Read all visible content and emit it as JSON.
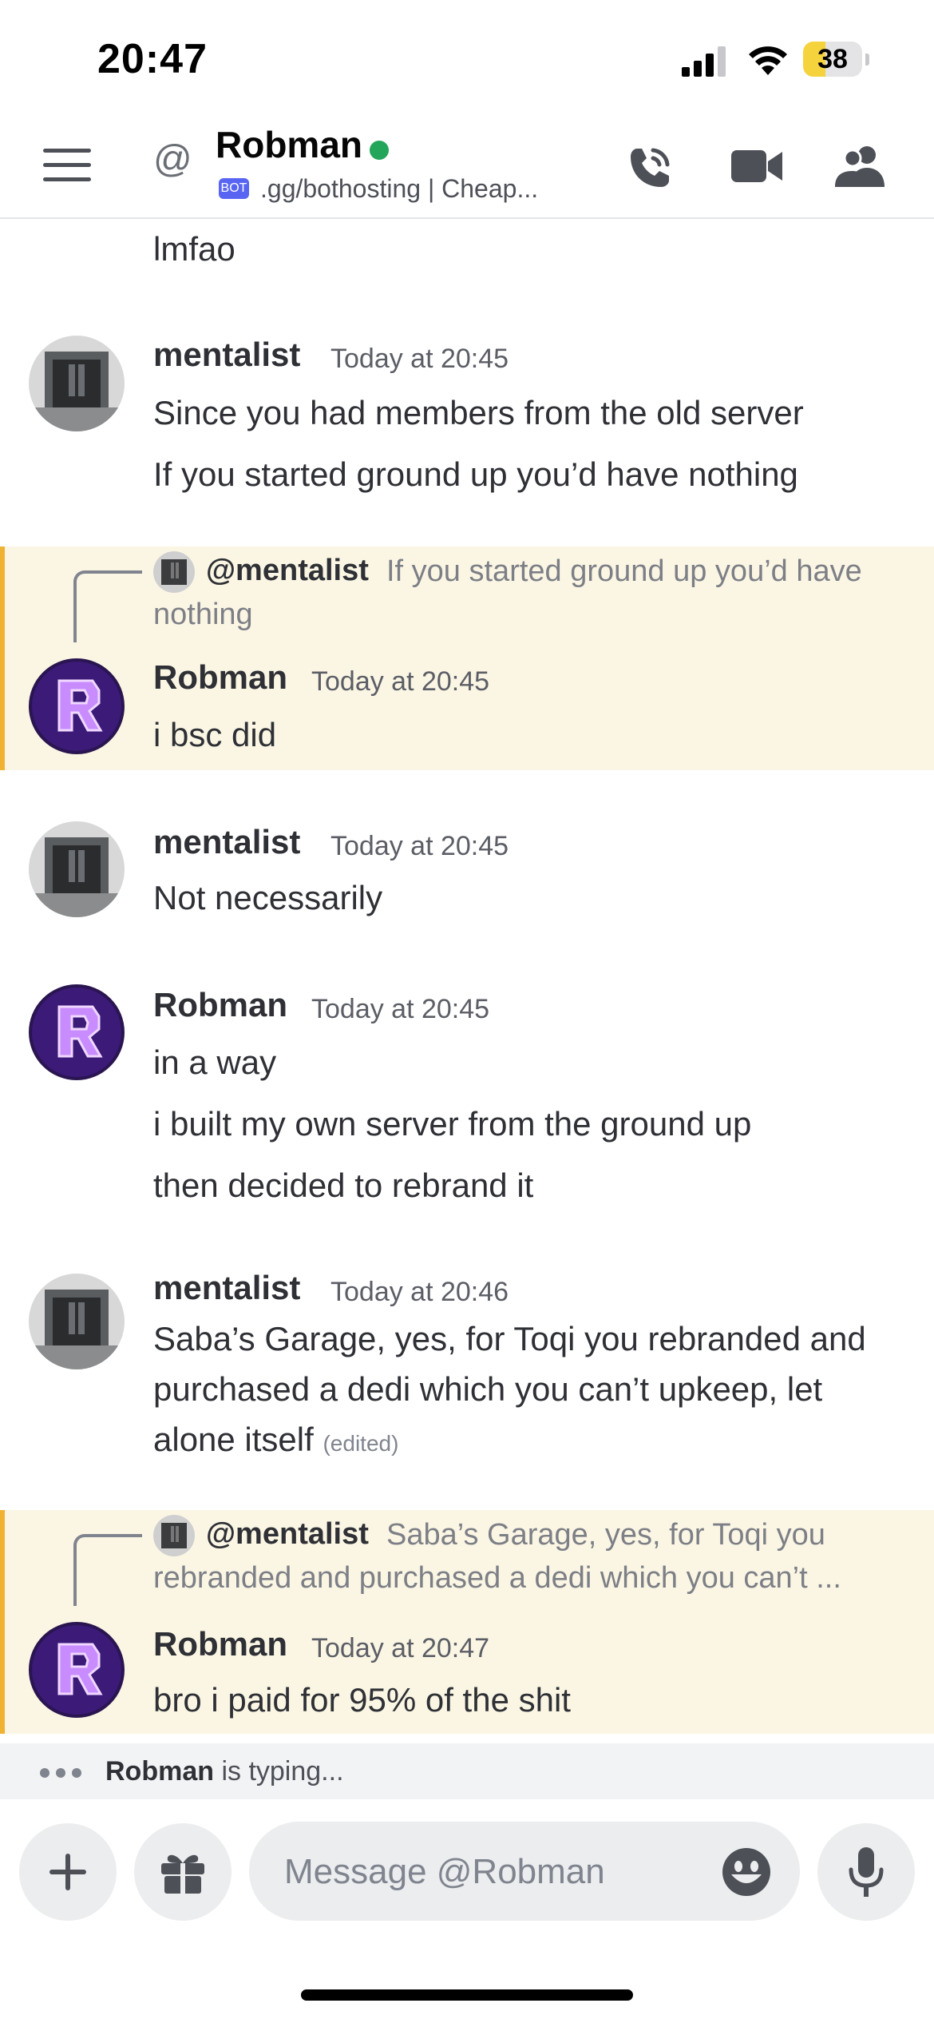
{
  "status_bar": {
    "time": "20:47",
    "battery": "38",
    "battery_level": 0.38
  },
  "header": {
    "at_symbol": "@",
    "name": "Robman",
    "bot_badge": "BOT",
    "status_text": ".gg/bothosting | Cheap...",
    "icons": [
      "menu-icon",
      "voice-call-icon",
      "video-call-icon",
      "members-icon"
    ]
  },
  "messages": [
    {
      "lines": [
        "lmfao"
      ]
    },
    {
      "author": "mentalist",
      "timestamp": "Today at 20:45",
      "lines": [
        "Since you had members from the old server",
        "If you started ground up you’d have nothing"
      ]
    },
    {
      "reply": {
        "name": "@mentalist",
        "text_line1": "If you started ground up you’d have",
        "text_line2": "nothing"
      },
      "author": "Robman",
      "timestamp": "Today at 20:45",
      "lines": [
        "i bsc did"
      ]
    },
    {
      "author": "mentalist",
      "timestamp": "Today at 20:45",
      "lines": [
        "Not necessarily"
      ]
    },
    {
      "author": "Robman",
      "timestamp": "Today at 20:45",
      "lines": [
        "in a way",
        "i built my own server from the ground up",
        "then decided to rebrand it"
      ]
    },
    {
      "author": "mentalist",
      "timestamp": "Today at 20:46",
      "lines": [
        "Saba’s Garage, yes, for Toqi you rebranded and",
        "purchased a dedi which you can’t upkeep, let",
        "alone itself"
      ],
      "edited": "(edited)"
    },
    {
      "reply": {
        "name": "@mentalist",
        "text_line1": "Saba’s Garage, yes, for Toqi you",
        "text_line2": "rebranded and purchased a dedi which you can’t ..."
      },
      "author": "Robman",
      "timestamp": "Today at 20:47",
      "lines": [
        "bro i paid for 95% of the shit"
      ]
    }
  ],
  "typing": {
    "name": "Robman",
    "suffix": " is typing..."
  },
  "composer": {
    "placeholder": "Message @Robman",
    "icons": [
      "plus-icon",
      "gift-icon",
      "emoji-icon",
      "microphone-icon"
    ]
  }
}
